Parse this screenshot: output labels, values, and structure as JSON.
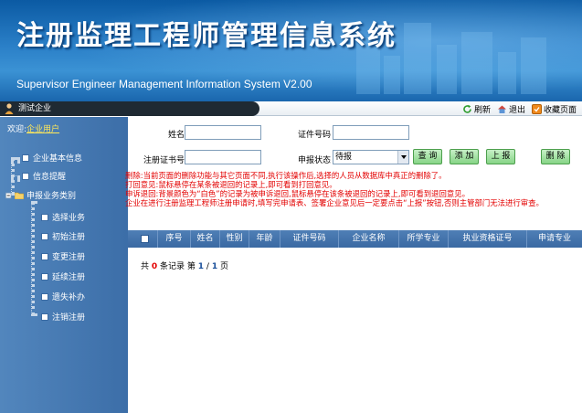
{
  "banner": {
    "title": "注册监理工程师管理信息系统",
    "subtitle": "Supervisor Engineer Management Information System V2.00"
  },
  "toolbar": {
    "user": "测试企业",
    "refresh_label": "刷新",
    "logout_label": "退出",
    "bookmark_label": "收藏页面"
  },
  "sidebar": {
    "head_prefix": "欢迎:",
    "head_user": "企业用户",
    "items": [
      {
        "label": "企业基本信息"
      },
      {
        "label": "信息提醒"
      },
      {
        "label": "申报业务类别"
      },
      {
        "label": "选择业务"
      },
      {
        "label": "初始注册"
      },
      {
        "label": "变更注册"
      },
      {
        "label": "延续注册"
      },
      {
        "label": "遗失补办"
      },
      {
        "label": "注销注册"
      }
    ]
  },
  "form": {
    "name_label": "姓名",
    "name_value": "",
    "idno_label": "证件号码",
    "idno_value": "",
    "cert_label": "注册证书号",
    "cert_value": "",
    "status_label": "申报状态",
    "status_value": "待报",
    "btn_query": "查 询",
    "btn_add": "添 加",
    "btn_submit": "上 报",
    "btn_delete": "删 除"
  },
  "notes": [
    "删除:当前页面的删除功能与其它页面不同,执行该操作后,选择的人员从数据库中真正的删除了。",
    "打回意见:鼠标悬停在某条被退回的记录上,即可看到打回意见。",
    "申诉退回:背景颜色为“白色”的记录为被申诉退回,鼠标悬停在该条被退回的记录上,即可看到退回意见。",
    "企业在进行注册监理工程师注册申请时,填写完申请表、签署企业意见后一定要点击“上报”按钮,否则主管部门无法进行审查。"
  ],
  "table": {
    "columns": [
      "序号",
      "姓名",
      "性别",
      "年龄",
      "证件号码",
      "企业名称",
      "所学专业",
      "执业资格证号",
      "申请专业"
    ]
  },
  "pager": {
    "prefix": "共",
    "count": "0",
    "suffix": "条记录  第",
    "page": "1",
    "sep": "/",
    "total": "1",
    "end": "页"
  },
  "colors": {
    "banner_blue": "#2a7fc7",
    "sidebar_blue": "#4a7db5",
    "note_red": "#e30000",
    "button_green": "#86d486"
  }
}
